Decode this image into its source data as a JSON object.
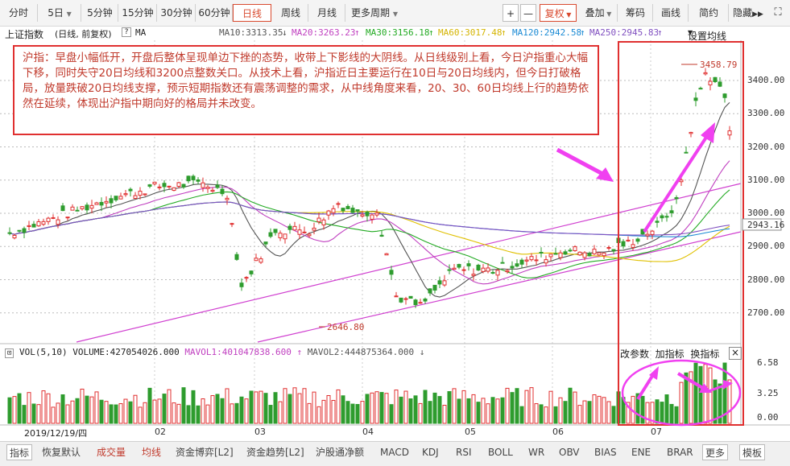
{
  "toolbar": {
    "periods": [
      "分时",
      "5日",
      "5分钟",
      "15分钟",
      "30分钟",
      "60分钟",
      "日线",
      "周线",
      "月线",
      "更多周期"
    ],
    "plus": "+",
    "minus": "—",
    "restore": "复权",
    "overlay": "叠加",
    "chips": "筹码",
    "draw": "画线",
    "simple": "简约",
    "hide": "隐藏"
  },
  "info": {
    "title": "上证指数",
    "mode": "(日线, 前复权)",
    "help": "?",
    "ma_label": "MA",
    "ma10": "MA10:3313.35",
    "ma20": "MA20:3263.23",
    "ma30": "MA30:3156.18",
    "ma60": "MA60:3017.48",
    "ma120": "MA120:2942.58",
    "ma250": "MA250:2945.83",
    "settings": "设置均线"
  },
  "annotation": "沪指：早盘小幅低开，开盘后整体呈现单边下挫的态势，收带上下影线的大阴线。从日线级别上看，今日沪指重心大幅下移，同时失守20日均线和3200点整数关口。从技术上看，沪指近日主要运行在10日与20日均线内，但今日打破格局，放量跌破20日均线支撑，预示短期指数还有震荡调整的需求，从中线角度来看，20、30、60日均线上行的趋势依然在延续，体现出沪指中期向好的格局并未改变。",
  "price_axis": [
    "3400.00",
    "3300.00",
    "3200.00",
    "3100.00",
    "3000.00",
    "2943.16",
    "2900.00",
    "2800.00",
    "2700.00"
  ],
  "high_label": "3458.79",
  "low_label": "2646.80",
  "volume": {
    "name": "VOL(5,10)",
    "volume": "VOLUME:427054026.000",
    "mavol1": "MAVOL1:401047838.600",
    "mavol2": "MAVOL2:444875364.000",
    "axis": [
      "6.58",
      "3.25",
      "0.00"
    ],
    "buttons": [
      "改参数",
      "加指标",
      "换指标"
    ],
    "close": "×"
  },
  "date_label": "2019/12/19/四",
  "months": [
    "02",
    "03",
    "04",
    "05",
    "06",
    "07"
  ],
  "bottom_tabs": [
    "指标",
    "恢复默认",
    "成交量",
    "均线",
    "资金博弈[L2]",
    "资金趋势[L2]",
    "沪股通净额",
    "MACD",
    "KDJ",
    "RSI",
    "BOLL",
    "WR",
    "OBV",
    "BIAS",
    "ENE",
    "BRAR",
    "更多",
    "模板"
  ],
  "colors": {
    "up": "#e03030",
    "down": "#2e9c2e",
    "ma10": "#555555",
    "ma20": "#c040c0",
    "ma30": "#22aa22",
    "ma60": "#e0c000",
    "ma120": "#1a8ad4",
    "ma250": "#8050c0",
    "accent": "#d94a2f"
  }
}
